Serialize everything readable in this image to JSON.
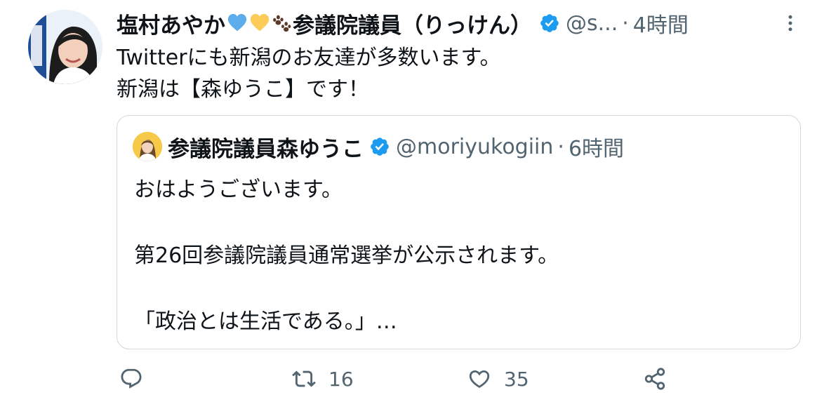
{
  "tweet": {
    "author": {
      "name": "塩村あやか",
      "handle": "@s...",
      "verified": true,
      "emoji": [
        "blue-heart-icon",
        "yellow-heart-icon",
        "paw-prints-icon"
      ],
      "name_suffix": "参議院議員（りっけん）"
    },
    "separator": "·",
    "time": "4時間",
    "text_lines": [
      "Twitterにも新潟のお友達が多数います。",
      "新潟は【森ゆうこ】です！"
    ]
  },
  "quoted": {
    "author": {
      "name": "参議院議員森ゆうこ",
      "handle": "@moriyukogiin",
      "verified": true
    },
    "separator": "·",
    "time": "6時間",
    "lines": [
      "おはようございます。",
      "第26回参議院議員通常選挙が公示されます。",
      "「政治とは生活である。」…"
    ]
  },
  "actions": {
    "reply_count": "",
    "retweet_count": "16",
    "like_count": "35"
  },
  "colors": {
    "verified": "#1d9bf0",
    "secondary_text": "#536471",
    "border": "#cfd9de"
  }
}
